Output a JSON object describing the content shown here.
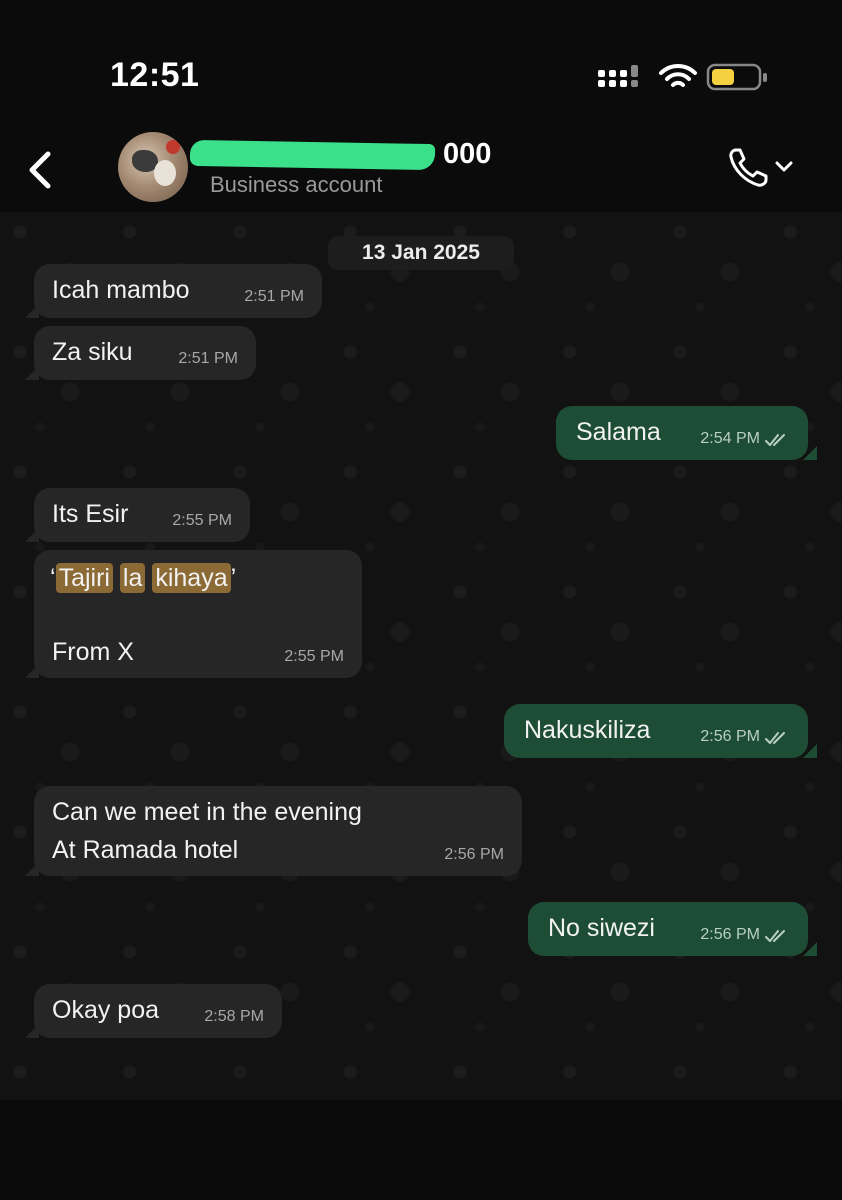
{
  "status_bar": {
    "time": "12:51",
    "icons": [
      "cellular-signal-icon",
      "wifi-icon",
      "battery-icon"
    ]
  },
  "header": {
    "contact_name_suffix": "000",
    "subtitle": "Business account",
    "icons": [
      "back-chevron-icon",
      "phone-call-icon",
      "chevron-down-icon"
    ]
  },
  "chat": {
    "date_label": "13 Jan 2025",
    "messages": [
      {
        "dir": "in",
        "text": "Icah mambo",
        "time": "2:51 PM"
      },
      {
        "dir": "in",
        "text": "Za siku",
        "time": "2:51 PM"
      },
      {
        "dir": "out",
        "text": "Salama",
        "time": "2:54 PM"
      },
      {
        "dir": "in",
        "text": "Its Esir",
        "time": "2:55 PM"
      },
      {
        "dir": "in",
        "quote_open": "‘",
        "words": [
          "Tajiri",
          "la",
          "kihaya"
        ],
        "quote_close": "’",
        "line2": "From X",
        "time": "2:55 PM"
      },
      {
        "dir": "out",
        "text": "Nakuskiliza",
        "time": "2:56 PM"
      },
      {
        "dir": "in",
        "line1": "Can we meet in the evening",
        "line2": "At Ramada hotel",
        "time": "2:56 PM"
      },
      {
        "dir": "out",
        "text": "No siwezi",
        "time": "2:56 PM"
      },
      {
        "dir": "in",
        "text": "Okay poa",
        "time": "2:58 PM"
      }
    ]
  },
  "colors": {
    "incoming_bubble": "#262626",
    "outgoing_bubble": "#1e4d35",
    "highlight": "#8c6a35",
    "redaction": "#3be08a",
    "battery": "#f5d142"
  }
}
